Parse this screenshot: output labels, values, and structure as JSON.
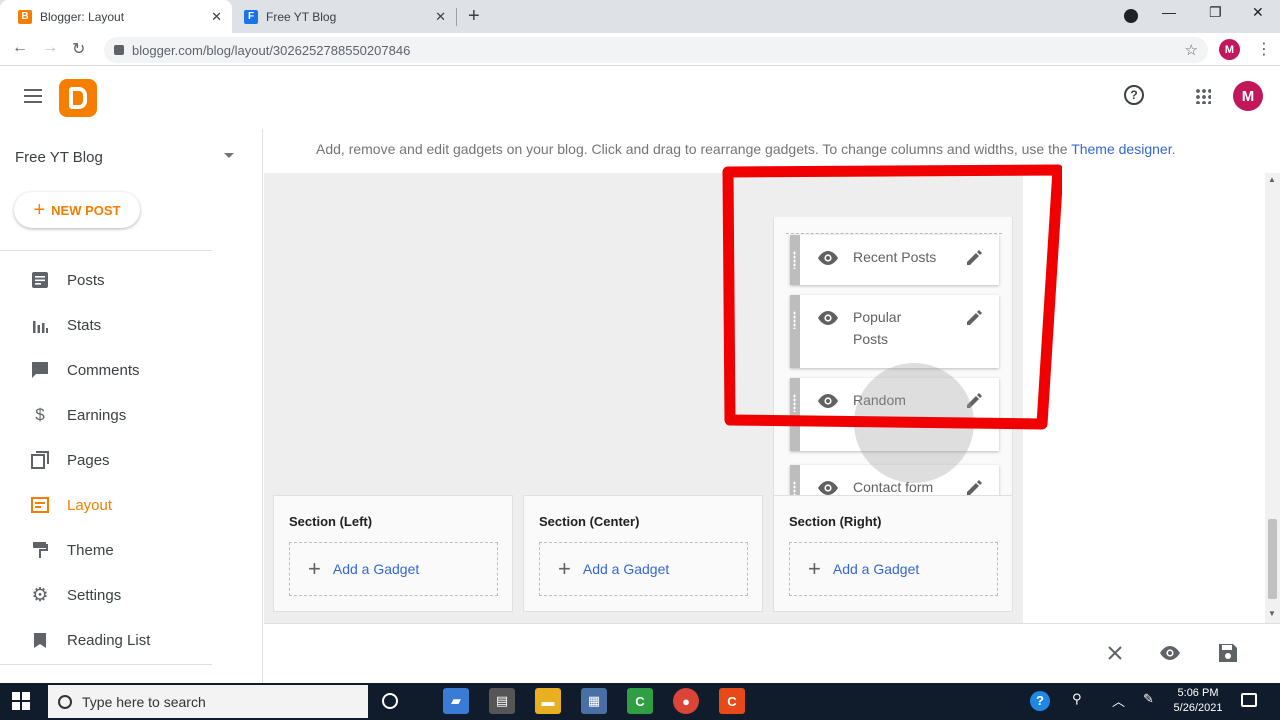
{
  "browser": {
    "tabs": [
      {
        "title": "Blogger: Layout",
        "favicon": "B",
        "favicon_color": "#f57d00",
        "active": true
      },
      {
        "title": "Free YT Blog",
        "favicon": "F",
        "favicon_color": "#1a73e8",
        "active": false
      }
    ],
    "url": "blogger.com/blog/layout/3026252788550207846",
    "profile_initial": "M"
  },
  "app": {
    "profile_initial": "M",
    "accent": "#f57d00"
  },
  "sidebar": {
    "blog_name": "Free YT Blog",
    "new_post_label": "NEW POST",
    "items": [
      {
        "label": "Posts",
        "icon": "posts-icon",
        "active": false
      },
      {
        "label": "Stats",
        "icon": "stats-icon",
        "active": false
      },
      {
        "label": "Comments",
        "icon": "comments-icon",
        "active": false
      },
      {
        "label": "Earnings",
        "icon": "dollar-icon",
        "active": false
      },
      {
        "label": "Pages",
        "icon": "pages-icon",
        "active": false
      },
      {
        "label": "Layout",
        "icon": "layout-icon",
        "active": true
      },
      {
        "label": "Theme",
        "icon": "paint-roller-icon",
        "active": false
      },
      {
        "label": "Settings",
        "icon": "gear-icon",
        "active": false
      },
      {
        "label": "Reading List",
        "icon": "bookmark-icon",
        "active": false
      }
    ]
  },
  "main": {
    "info_text": "Add, remove and edit gadgets on your blog. Click and drag to rearrange gadgets. To change columns and widths, use the ",
    "info_link": "Theme designer",
    "info_end": ".",
    "gadgets": [
      {
        "name": "Recent Posts"
      },
      {
        "name": "Popular Posts"
      },
      {
        "name": "Random Posts"
      },
      {
        "name": "Contact form"
      }
    ],
    "sections": [
      {
        "title": "Section (Left)",
        "add_label": "Add a Gadget"
      },
      {
        "title": "Section (Center)",
        "add_label": "Add a Gadget"
      },
      {
        "title": "Section (Right)",
        "add_label": "Add a Gadget"
      }
    ]
  },
  "taskbar": {
    "search_placeholder": "Type here to search",
    "time": "5:06 PM",
    "date": "5/26/2021"
  }
}
